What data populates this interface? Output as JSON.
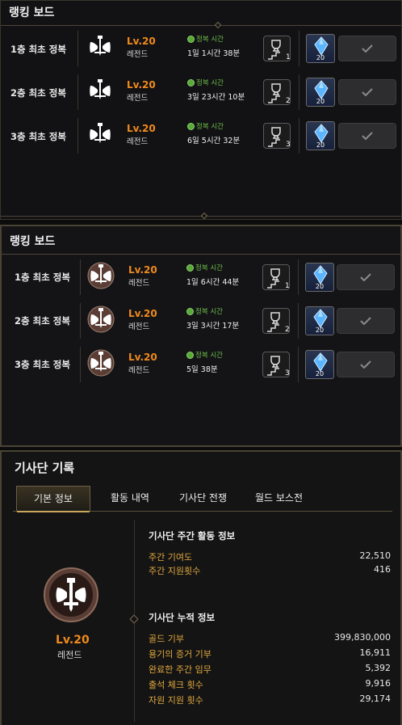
{
  "board1": {
    "title": "랭킹 보드",
    "rows": [
      {
        "label": "1층 최초 정복",
        "level": "Lv.20",
        "rank": "레전드",
        "time_label": "정복 시간",
        "time": "1일 1시간 38분",
        "floor": "1",
        "gem_count": "20"
      },
      {
        "label": "2층 최초 정복",
        "level": "Lv.20",
        "rank": "레전드",
        "time_label": "정복 시간",
        "time": "3일 23시간 10분",
        "floor": "2",
        "gem_count": "20"
      },
      {
        "label": "3층 최초 정복",
        "level": "Lv.20",
        "rank": "레전드",
        "time_label": "정복 시간",
        "time": "6일 5시간 32분",
        "floor": "3",
        "gem_count": "20"
      }
    ]
  },
  "board2": {
    "title": "랭킹 보드",
    "rows": [
      {
        "label": "1층 최초 정복",
        "level": "Lv.20",
        "rank": "레전드",
        "time_label": "정복 시간",
        "time": "1일 6시간 44분",
        "floor": "1",
        "gem_count": "20"
      },
      {
        "label": "2층 최초 정복",
        "level": "Lv.20",
        "rank": "레전드",
        "time_label": "정복 시간",
        "time": "3일 3시간 17분",
        "floor": "2",
        "gem_count": "20"
      },
      {
        "label": "3층 최초 정복",
        "level": "Lv.20",
        "rank": "레전드",
        "time_label": "정복 시간",
        "time": "5일 38분",
        "floor": "3",
        "gem_count": "20"
      }
    ]
  },
  "guild": {
    "title": "기사단 기록",
    "tabs": [
      "기본 정보",
      "활동 내역",
      "기사단 전쟁",
      "월드 보스전"
    ],
    "active_tab": "기본 정보",
    "level": "Lv.20",
    "rank": "레전드",
    "weekly_title": "기사단 주간 활동 정보",
    "weekly": [
      {
        "label": "주간 기여도",
        "value": "22,510"
      },
      {
        "label": "주간 지원횟수",
        "value": "416"
      }
    ],
    "total_title": "기사단 누적 정보",
    "total": [
      {
        "label": "골드 기부",
        "value": "399,830,000"
      },
      {
        "label": "용기의 증거 기부",
        "value": "16,911"
      },
      {
        "label": "완료한 주간 임무",
        "value": "5,392"
      },
      {
        "label": "출석 체크 횟수",
        "value": "9,916"
      },
      {
        "label": "자원 지원 횟수",
        "value": "29,174"
      }
    ]
  },
  "colors": {
    "accent": "#f08a1c",
    "green": "#6fc04a",
    "gold": "#e1a93f"
  }
}
